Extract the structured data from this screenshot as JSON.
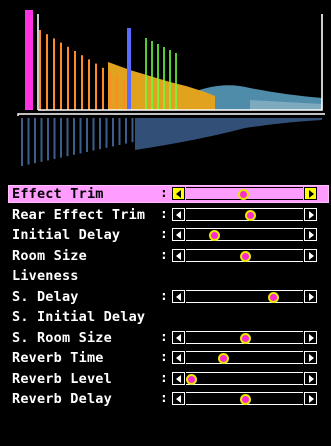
{
  "graph": {
    "colors": {
      "early_direct": "#ff33e0",
      "early_reflections": "#ff8a2a",
      "reflections_fill": "#e1a21e",
      "marker": "#5a6cff",
      "late_reflections": "#6aff42",
      "reverb_tail": "#4e8caa",
      "reverb_tail_light": "#93b7c8",
      "frame": "#ffffff",
      "mirror": "#3b5e8c"
    }
  },
  "params": [
    {
      "label": "Effect Trim",
      "colon": ":",
      "slider": true,
      "level": 0.49,
      "selected": true
    },
    {
      "label": "Rear Effect Trim",
      "colon": ":",
      "slider": true,
      "level": 0.55,
      "selected": false
    },
    {
      "label": "Initial Delay",
      "colon": ":",
      "slider": true,
      "level": 0.24,
      "selected": false
    },
    {
      "label": "Room Size",
      "colon": ":",
      "slider": true,
      "level": 0.5,
      "selected": false
    },
    {
      "label": "Liveness",
      "colon": "",
      "slider": false,
      "selected": false
    },
    {
      "label": "S. Delay",
      "colon": ":",
      "slider": true,
      "level": 0.74,
      "selected": false
    },
    {
      "label": "S. Initial Delay",
      "colon": "",
      "slider": false,
      "selected": false
    },
    {
      "label": "S. Room Size",
      "colon": ":",
      "slider": true,
      "level": 0.5,
      "selected": false
    },
    {
      "label": "Reverb Time",
      "colon": ":",
      "slider": true,
      "level": 0.32,
      "selected": false
    },
    {
      "label": "Reverb Level",
      "colon": ":",
      "slider": true,
      "level": 0.04,
      "selected": false
    },
    {
      "label": "Reverb Delay",
      "colon": ":",
      "slider": true,
      "level": 0.5,
      "selected": false
    }
  ]
}
